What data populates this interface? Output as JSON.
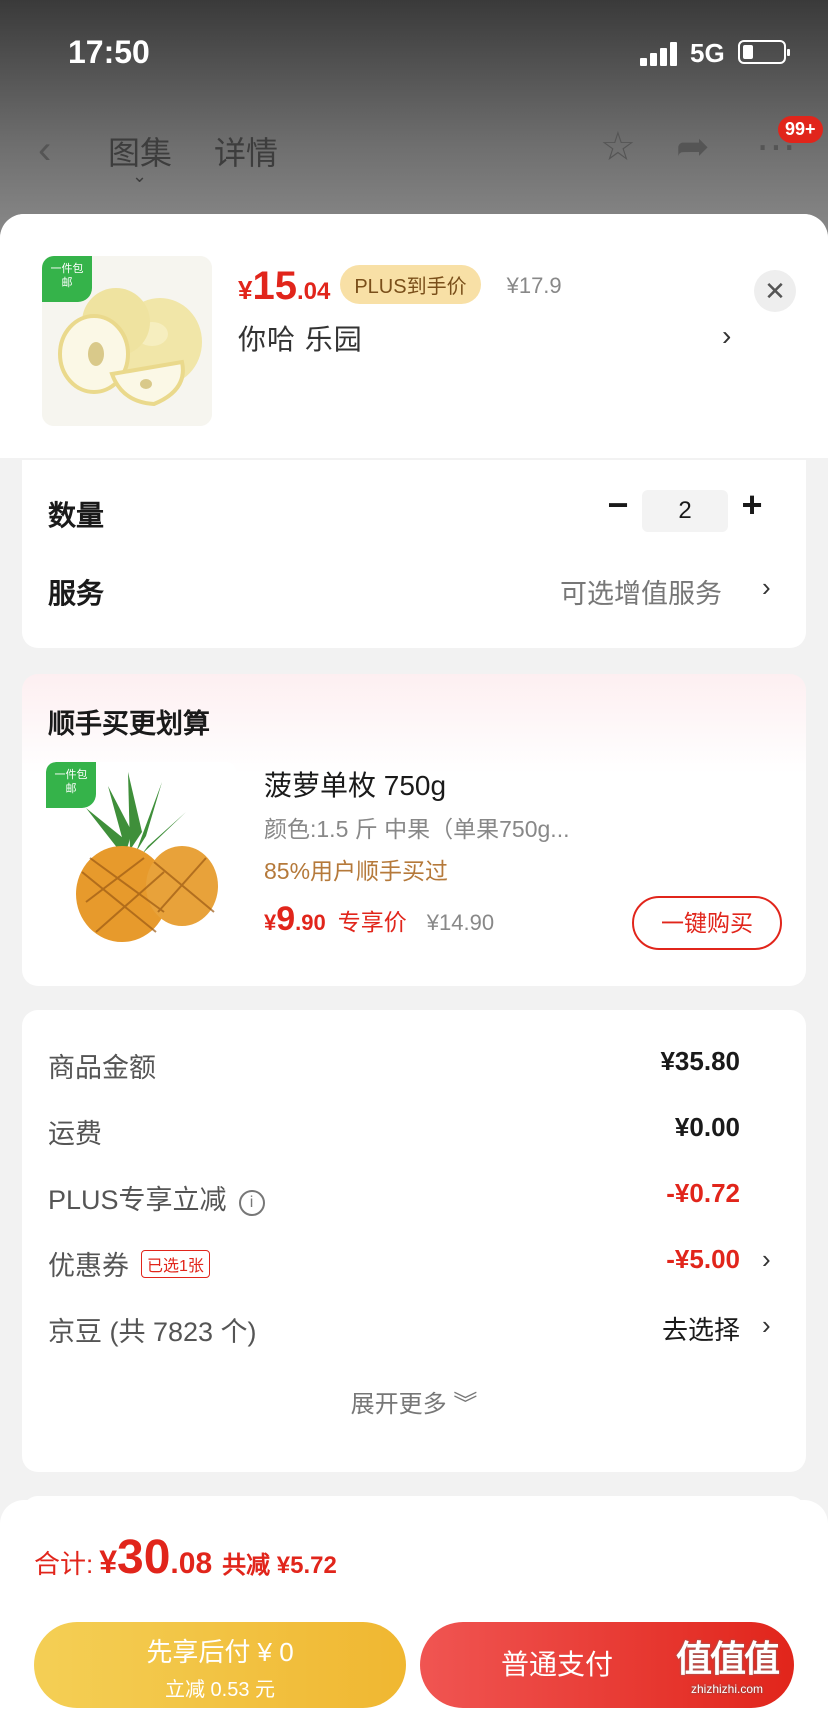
{
  "status_bar": {
    "time": "17:50",
    "network": "5G"
  },
  "nav": {
    "back_icon": "chevron-left-icon",
    "tabs": [
      {
        "label": "图集"
      },
      {
        "label": "详情"
      }
    ],
    "badge": "99+"
  },
  "product": {
    "tag": "一件包邮",
    "price_currency": "¥",
    "price_int": "15",
    "price_dec": ".04",
    "plus_tag": "PLUS到手价",
    "original_price": "¥17.9",
    "spec": "你哈  乐园",
    "arrow": "›",
    "close": "✕"
  },
  "quantity": {
    "label": "数量",
    "minus": "−",
    "value": "2",
    "plus": "+"
  },
  "service": {
    "label": "服务",
    "value": "可选增值服务",
    "arrow": "›"
  },
  "upsell": {
    "title": "顺手买更划算",
    "tag": "一件包邮",
    "name": "菠萝单枚 750g",
    "spec": "颜色:1.5 斤 中果（单果750g...",
    "percent": "85%用户顺手买过",
    "price_currency": "¥",
    "price_int": "9",
    "price_dec": ".90",
    "exclusive": "专享价",
    "original_price": "¥14.90",
    "buy_label": "一键购买"
  },
  "summary": {
    "rows": [
      {
        "label": "商品金额",
        "value": "¥35.80"
      },
      {
        "label": "运费",
        "value": "¥0.00"
      },
      {
        "label": "PLUS专享立减",
        "value": "-¥0.72",
        "info": "i"
      },
      {
        "label": "优惠券",
        "value": "-¥5.00",
        "tag": "已选1张",
        "arrow": "›"
      },
      {
        "label": "京豆 (共 7823 个)",
        "value": "去选择",
        "arrow": "›"
      }
    ],
    "expand": "展开更多 ︾"
  },
  "footer": {
    "total_label": "合计:",
    "total_currency": "¥",
    "total_int": "30",
    "total_dec": ".08",
    "total_save": "共减 ¥5.72",
    "pay_later_line1": "先享后付 ¥ 0",
    "pay_later_line2": "立减 0.53 元",
    "pay_normal": "普通支付"
  },
  "watermark": {
    "text": "值值值",
    "domain": "zhizhizhi.com"
  },
  "colors": {
    "accent_red": "#e1251b",
    "plus_gold": "#f8e0a6",
    "pay_later_yellow": "#f0b731",
    "free_ship_green": "#35b34a"
  }
}
